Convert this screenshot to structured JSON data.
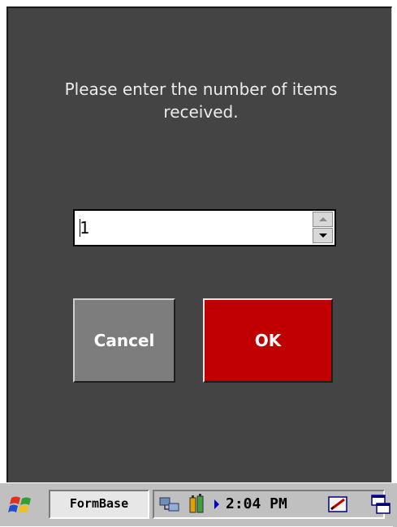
{
  "dialog": {
    "prompt": "Please enter the number of items\nreceived.",
    "quantity_value": "1",
    "cancel_label": "Cancel",
    "ok_label": "OK"
  },
  "colors": {
    "dialog_background": "#444444",
    "ok_button": "#c00000",
    "cancel_button": "#7d7d7d",
    "taskbar": "#c0c0c0"
  },
  "taskbar": {
    "start_icon": "windows-flag-icon",
    "active_app_label": "FormBase",
    "tray_icons": [
      "network-icon",
      "battery-icon",
      "tray-expand-arrow-icon"
    ],
    "clock": "2:04 PM",
    "input_panel_icon": "input-panel-icon",
    "desktop_icon": "show-desktop-icon"
  }
}
